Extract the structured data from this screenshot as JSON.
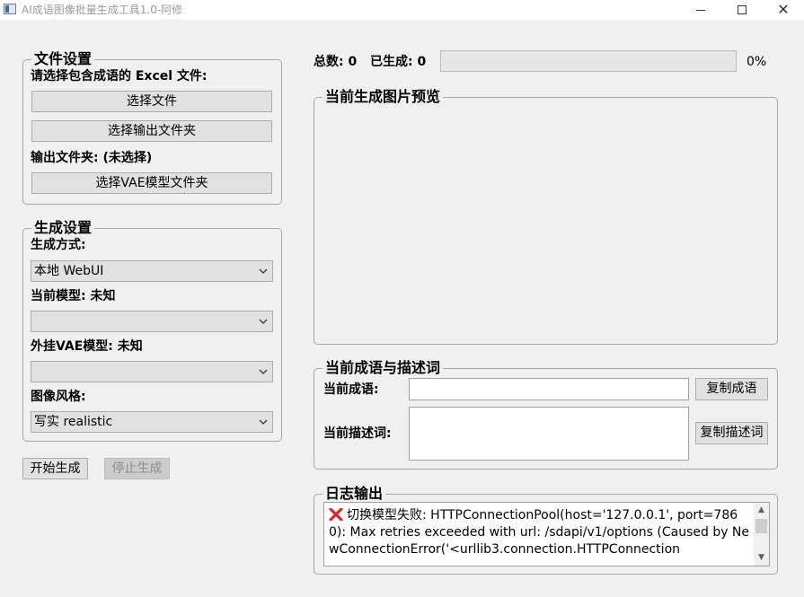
{
  "window": {
    "title": "AI成语图像批量生成工具1.0-阿修",
    "app_icon": "app-window-icon",
    "minimize_icon": "minimize-icon",
    "maximize_icon": "maximize-icon",
    "close_icon": "close-icon",
    "close_glyph": "✕"
  },
  "file_settings": {
    "title": "文件设置",
    "prompt_label": "请选择包含成语的 Excel 文件:",
    "select_file_button": "选择文件",
    "select_output_button": "选择输出文件夹",
    "output_folder_label": "输出文件夹: (未选择)",
    "select_vae_button": "选择VAE模型文件夹"
  },
  "generation_settings": {
    "title": "生成设置",
    "mode_label": "生成方式:",
    "mode_value": "本地 WebUI",
    "model_label": "当前模型: 未知",
    "model_value": "",
    "vae_label": "外挂VAE模型: 未知",
    "vae_value": "",
    "style_label": "图像风格:",
    "style_value": "写实 realistic"
  },
  "actions": {
    "start_button": "开始生成",
    "stop_button": "停止生成"
  },
  "stats": {
    "total_label": "总数: 0",
    "generated_label": "已生成: 0",
    "progress_percent_text": "0%",
    "progress_value": 0
  },
  "preview": {
    "title": "当前生成图片预览"
  },
  "idiom_panel": {
    "title": "当前成语与描述词",
    "idiom_label": "当前成语:",
    "idiom_value": "",
    "description_label": "当前描述词:",
    "description_value": "",
    "copy_idiom_button": "复制成语",
    "copy_description_button": "复制描述词"
  },
  "log": {
    "title": "日志输出",
    "error_icon": "error-x-icon",
    "message": "切换模型失败: HTTPConnectionPool(host='127.0.0.1', port=7860): Max retries exceeded with url: /sdapi/v1/options (Caused by NewConnectionError('<urllib3.connection.HTTPConnection",
    "scroll_up_icon": "scroll-up-icon",
    "scroll_down_icon": "scroll-down-icon"
  },
  "colors": {
    "error_red": "#d9262b",
    "window_bg": "#f0f0f0",
    "button_bg": "#e1e1e1",
    "progress_green": "#06b025"
  }
}
